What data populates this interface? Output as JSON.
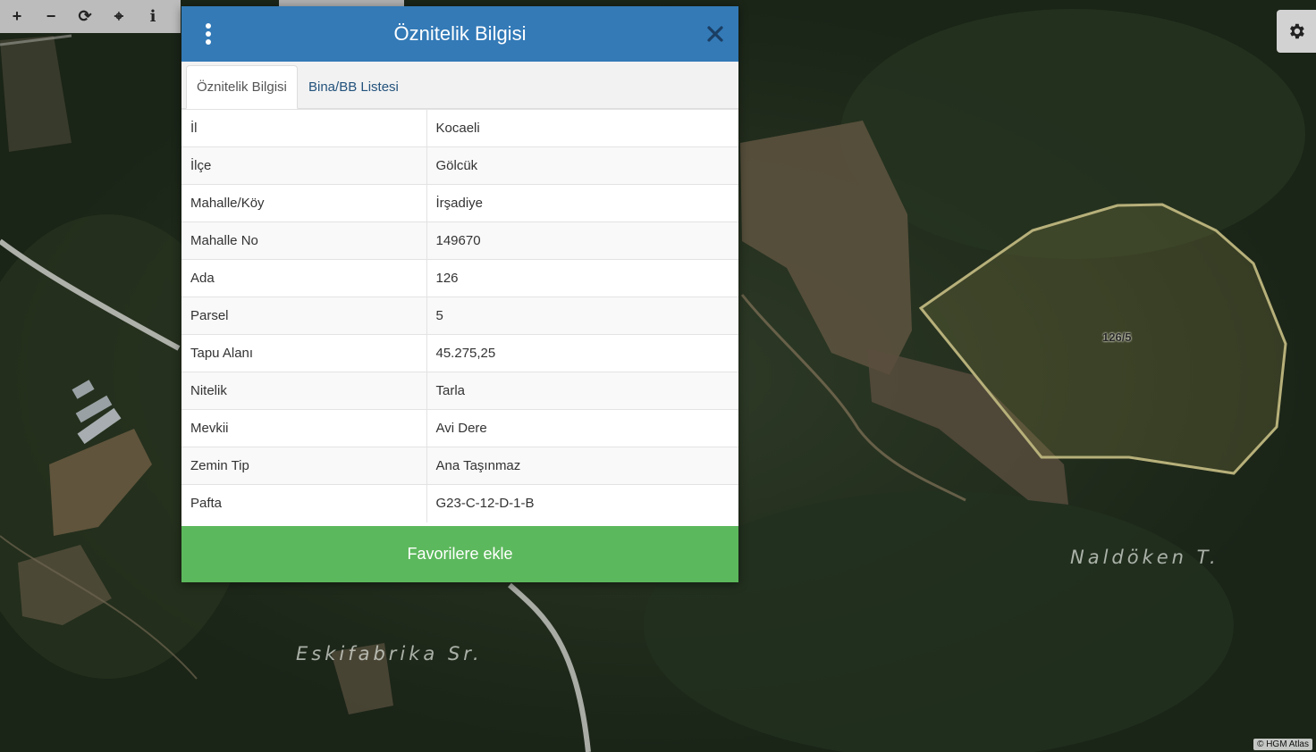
{
  "toolbar": {
    "buttons": [
      {
        "name": "zoom-in-button",
        "icon": "plus-icon",
        "glyph": "+"
      },
      {
        "name": "zoom-out-button",
        "icon": "minus-icon",
        "glyph": "−"
      },
      {
        "name": "refresh-button",
        "icon": "refresh-icon",
        "glyph": "⟳"
      },
      {
        "name": "locate-button",
        "icon": "crosshair-icon",
        "glyph": "⌖"
      },
      {
        "name": "info-button",
        "icon": "info-icon",
        "glyph": "i"
      }
    ]
  },
  "settings": {
    "icon": "gear-icon"
  },
  "map": {
    "parcel_label": "126/5",
    "place_labels": [
      "Naldöken T.",
      "Eskifabrika Sr."
    ],
    "attribution": "© HGM Atlas"
  },
  "panel": {
    "title": "Öznitelik Bilgisi",
    "menu_icon": "vertical-dots-icon",
    "close_icon": "close-icon",
    "tabs": [
      {
        "label": "Öznitelik Bilgisi",
        "active": true
      },
      {
        "label": "Bina/BB Listesi",
        "active": false
      }
    ],
    "rows": [
      {
        "key": "İl",
        "value": "Kocaeli"
      },
      {
        "key": "İlçe",
        "value": "Gölcük"
      },
      {
        "key": "Mahalle/Köy",
        "value": "İrşadiye"
      },
      {
        "key": "Mahalle No",
        "value": "149670"
      },
      {
        "key": "Ada",
        "value": "126"
      },
      {
        "key": "Parsel",
        "value": "5"
      },
      {
        "key": "Tapu Alanı",
        "value": "45.275,25"
      },
      {
        "key": "Nitelik",
        "value": "Tarla"
      },
      {
        "key": "Mevkii",
        "value": "Avi Dere"
      },
      {
        "key": "Zemin Tip",
        "value": "Ana Taşınmaz"
      },
      {
        "key": "Pafta",
        "value": "G23-C-12-D-1-B"
      }
    ],
    "favorite_button": "Favorilere ekle"
  },
  "colors": {
    "header": "#337ab7",
    "favorite_button": "#5cb85c",
    "tab_link": "#23527c",
    "parcel_outline": "#b7b07a"
  }
}
